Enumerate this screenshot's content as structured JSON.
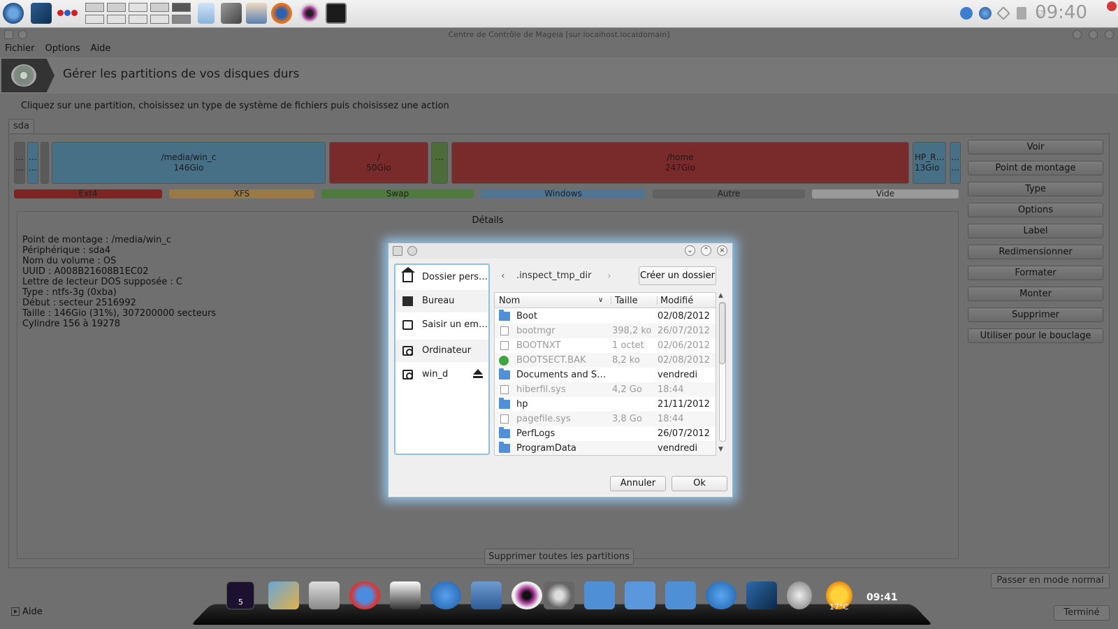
{
  "top_panel": {
    "clock": "09:40",
    "icons": [
      "mageia-icon",
      "desktop-icon",
      "dots-icon",
      "desktop-switcher-icon",
      "clipboard-icon",
      "tools-icon",
      "network-icon",
      "firefox-icon",
      "eye-icon",
      "terminal-icon"
    ],
    "tray": [
      "help-icon",
      "globe-icon",
      "network-tray-icon",
      "volume-icon",
      "chevron-down-icon"
    ]
  },
  "window": {
    "title": "Centre de Contrôle de Mageia  [sur localhost.localdomain]",
    "menu": [
      "Fichier",
      "Options",
      "Aide"
    ],
    "banner_title": "Gérer les partitions de vos disques durs",
    "instruction": "Cliquez sur une partition, choisissez un type de système de fichiers puis choisissez une action",
    "tab": "sda"
  },
  "partitions": [
    {
      "label": "…",
      "size": "…"
    },
    {
      "label": "…",
      "size": "…"
    },
    {
      "label": "",
      "size": ""
    },
    {
      "label": "/media/win_c",
      "size": "146Gio"
    },
    {
      "label": "/",
      "size": "50Gio"
    },
    {
      "label": "",
      "size": "…"
    },
    {
      "label": "/home",
      "size": "247Gio"
    },
    {
      "label": "HP_R…",
      "size": "13Gio"
    },
    {
      "label": "…",
      "size": "…"
    }
  ],
  "legend": [
    "Ext4",
    "XFS",
    "Swap",
    "Windows",
    "Autre",
    "Vide"
  ],
  "legend_colors": {
    "Ext4": "#7e2424",
    "XFS": "#9a7a44",
    "Swap": "#4e7a3d",
    "Windows": "#4f7591",
    "Autre": "#626262",
    "Vide": "#9a9a9a"
  },
  "actions": [
    "Voir",
    "Point de montage",
    "Type",
    "Options",
    "Label",
    "Redimensionner",
    "Formater",
    "Monter",
    "Supprimer",
    "Utiliser pour le bouclage"
  ],
  "details": {
    "title": "Détails",
    "lines": [
      "Point de montage : /media/win_c",
      "Périphérique : sda4",
      "Nom du volume : OS",
      "UUID : A008B21608B1EC02",
      "Lettre de lecteur DOS supposée : C",
      "Type : ntfs-3g (0xba)",
      "Début : secteur 2516992",
      "Taille : 146Gio (31%), 307200000 secteurs",
      "Cylindre 156 à 19278"
    ]
  },
  "bottom": {
    "delete_all": "Supprimer toutes les partitions",
    "normal_mode": "Passer en mode normal",
    "done": "Terminé",
    "help": "Aide"
  },
  "dock": {
    "clock": "09:41",
    "temperature": "17°C",
    "workspace": "5"
  },
  "dialog": {
    "places": [
      {
        "label": "Dossier pers…",
        "icon": "home-icon"
      },
      {
        "label": "Bureau",
        "icon": "desktop-folder-icon"
      },
      {
        "label": "Saisir un em…",
        "icon": "location-icon"
      },
      {
        "label": "Ordinateur",
        "icon": "drive-icon"
      },
      {
        "label": "win_d",
        "icon": "drive-icon"
      }
    ],
    "path": ".inspect_tmp_dir",
    "create_folder": "Créer un dossier",
    "columns": {
      "name": "Nom",
      "size": "Taille",
      "modified": "Modifié"
    },
    "files": [
      {
        "name": "Boot",
        "size": "",
        "modified": "02/08/2012",
        "type": "folder"
      },
      {
        "name": "bootmgr",
        "size": "398,2 ko",
        "modified": "26/07/2012",
        "type": "file"
      },
      {
        "name": "BOOTNXT",
        "size": "1 octet",
        "modified": "02/06/2012",
        "type": "file"
      },
      {
        "name": "BOOTSECT.BAK",
        "size": "8,2 ko",
        "modified": "02/08/2012",
        "type": "gear"
      },
      {
        "name": "Documents and S…",
        "size": "",
        "modified": "vendredi",
        "type": "folder"
      },
      {
        "name": "hiberfil.sys",
        "size": "4,2 Go",
        "modified": "18:44",
        "type": "file"
      },
      {
        "name": "hp",
        "size": "",
        "modified": "21/11/2012",
        "type": "folder"
      },
      {
        "name": "pagefile.sys",
        "size": "3,8 Go",
        "modified": "18:44",
        "type": "file"
      },
      {
        "name": "PerfLogs",
        "size": "",
        "modified": "26/07/2012",
        "type": "folder"
      },
      {
        "name": "ProgramData",
        "size": "",
        "modified": "vendredi",
        "type": "folder"
      }
    ],
    "cancel": "Annuler",
    "ok": "Ok"
  }
}
